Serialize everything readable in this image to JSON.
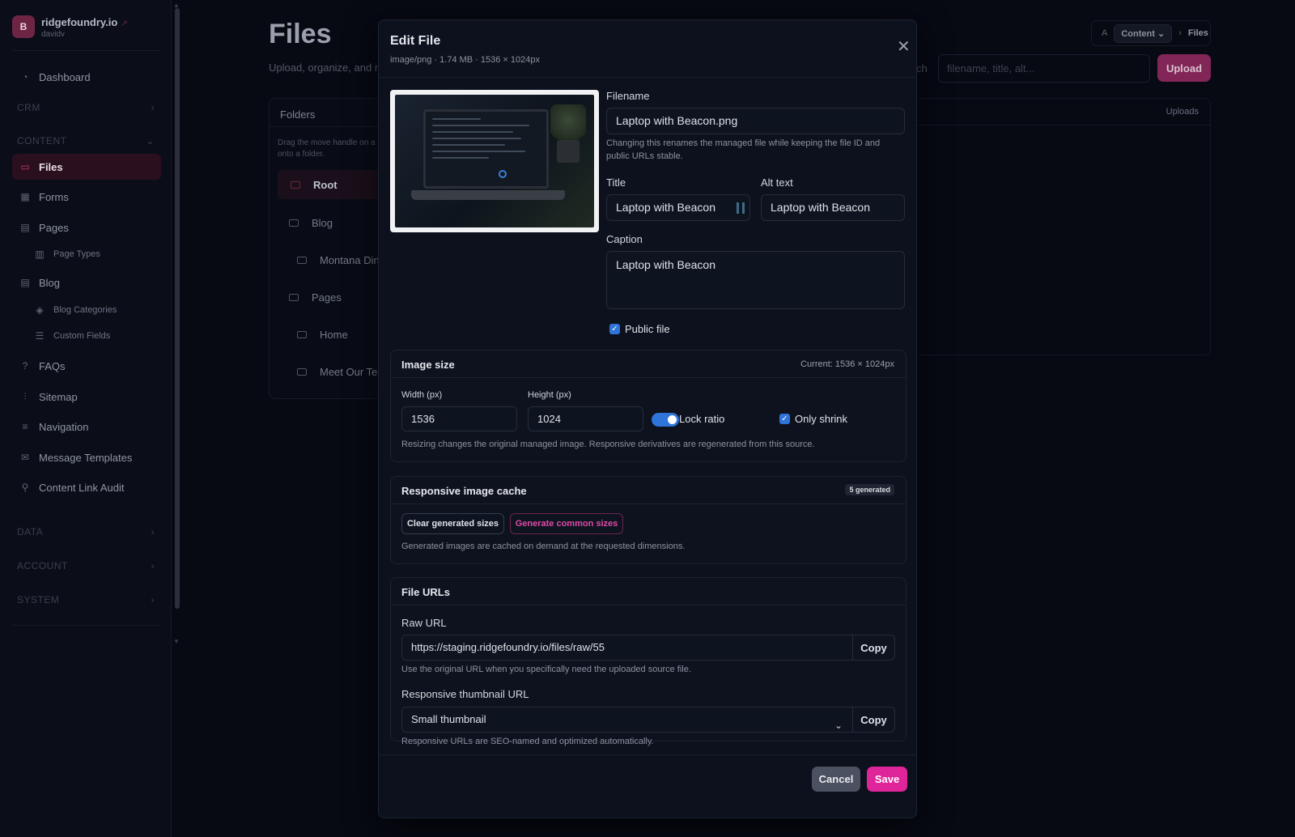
{
  "brand": {
    "initial": "B",
    "name": "ridgefoundry.io",
    "user": "davidv"
  },
  "sidebar": {
    "items": [
      {
        "label": "Dashboard",
        "icon": "dashboard-icon"
      },
      {
        "label": "Files",
        "icon": "folder-icon",
        "active": true
      },
      {
        "label": "Forms",
        "icon": "grid-icon"
      },
      {
        "label": "Pages",
        "icon": "document-icon"
      },
      {
        "label": "Page Types",
        "icon": "layout-icon"
      },
      {
        "label": "Blog",
        "icon": "blog-icon"
      },
      {
        "label": "Blog Categories",
        "icon": "tag-icon"
      },
      {
        "label": "Custom Fields",
        "icon": "fields-icon"
      },
      {
        "label": "FAQs",
        "icon": "help-icon"
      },
      {
        "label": "Sitemap",
        "icon": "sitemap-icon"
      },
      {
        "label": "Navigation",
        "icon": "menu-icon"
      },
      {
        "label": "Message Templates",
        "icon": "mail-icon"
      },
      {
        "label": "Content Link Audit",
        "icon": "link-icon"
      }
    ],
    "groups": {
      "crm": "CRM",
      "content": "CONTENT",
      "data": "DATA",
      "account": "ACCOUNT",
      "system": "SYSTEM"
    }
  },
  "page": {
    "title": "Files",
    "subtitle": "Upload, organize, and m",
    "folders_title": "Folders",
    "folders_hint": "Drag the move handle on a onto a folder.",
    "folders": [
      "Root",
      "Blog",
      "Montana Din",
      "Pages",
      "Home",
      "Meet Our Tea"
    ],
    "search_partial": "ch",
    "search_placeholder": "filename, title, alt...",
    "upload_label": "Upload",
    "crumb_root": "A",
    "crumb_content": "Content",
    "crumb_files": "Files",
    "uploads_label": "Uploads"
  },
  "modal": {
    "title": "Edit File",
    "meta": "image/png · 1.74 MB · 1536 × 1024px",
    "filename_label": "Filename",
    "filename_value": "Laptop with Beacon.png",
    "filename_help": "Changing this renames the managed file while keeping the file ID and public URLs stable.",
    "title_label": "Title",
    "title_value": "Laptop with Beacon",
    "alt_label": "Alt text",
    "alt_value": "Laptop with Beacon",
    "caption_label": "Caption",
    "caption_value": "Laptop with Beacon",
    "public_label": "Public file",
    "image_size": {
      "title": "Image size",
      "current": "Current: 1536 × 1024px",
      "width_label": "Width (px)",
      "width_value": "1536",
      "height_label": "Height (px)",
      "height_value": "1024",
      "lock_label": "Lock ratio",
      "shrink_label": "Only shrink",
      "help": "Resizing changes the original managed image. Responsive derivatives are regenerated from this source."
    },
    "cache": {
      "title": "Responsive image cache",
      "badge": "5 generated",
      "clear_label": "Clear generated sizes",
      "generate_label": "Generate common sizes",
      "help": "Generated images are cached on demand at the requested dimensions."
    },
    "urls": {
      "title": "File URLs",
      "raw_label": "Raw URL",
      "raw_value": "https://staging.ridgefoundry.io/files/raw/55",
      "copy_label": "Copy",
      "raw_help": "Use the original URL when you specifically need the uploaded source file.",
      "thumb_label": "Responsive thumbnail URL",
      "thumb_selected": "Small thumbnail",
      "thumb_help": "Responsive URLs are SEO-named and optimized automatically."
    },
    "cancel_label": "Cancel",
    "save_label": "Save"
  },
  "colors": {
    "accent": "#e0249a",
    "brand": "#6e2545",
    "toggle": "#2f74d9",
    "background": "#070913"
  }
}
